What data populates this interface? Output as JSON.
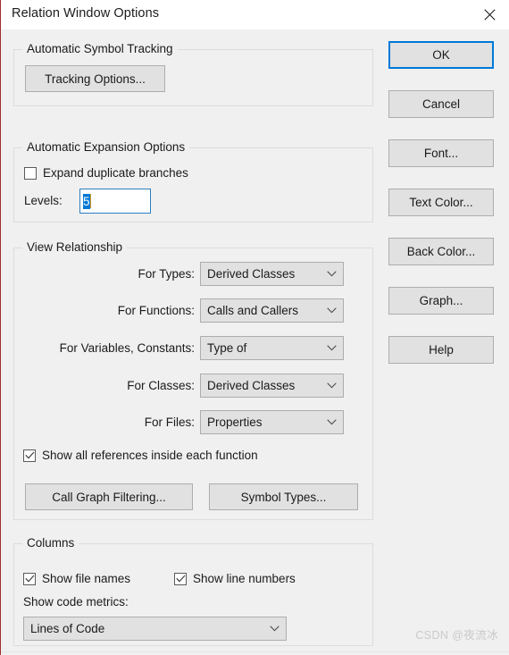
{
  "window": {
    "title": "Relation Window Options",
    "close_icon": "close-icon"
  },
  "groups": {
    "tracking": {
      "legend": "Automatic Symbol Tracking",
      "tracking_options_button": "Tracking Options..."
    },
    "expansion": {
      "legend": "Automatic Expansion Options",
      "expand_duplicate_branches": {
        "label": "Expand duplicate branches",
        "checked": false
      },
      "levels_label": "Levels:",
      "levels_value": "5"
    },
    "view_relationship": {
      "legend": "View Relationship",
      "rows": [
        {
          "label": "For Types:",
          "value": "Derived Classes"
        },
        {
          "label": "For Functions:",
          "value": "Calls and Callers"
        },
        {
          "label": "For Variables, Constants:",
          "value": "Type of"
        },
        {
          "label": "For Classes:",
          "value": "Derived Classes"
        },
        {
          "label": "For Files:",
          "value": "Properties"
        }
      ],
      "show_all_references": {
        "label": "Show all references inside each function",
        "checked": true
      },
      "call_graph_filtering_button": "Call Graph Filtering...",
      "symbol_types_button": "Symbol Types..."
    },
    "columns": {
      "legend": "Columns",
      "show_file_names": {
        "label": "Show file names",
        "checked": true
      },
      "show_line_numbers": {
        "label": "Show line numbers",
        "checked": true
      },
      "show_code_metrics_label": "Show code metrics:",
      "show_code_metrics_value": "Lines of Code"
    }
  },
  "buttons": [
    {
      "label": "OK",
      "default": true
    },
    {
      "label": "Cancel",
      "default": false
    },
    {
      "label": "Font...",
      "default": false
    },
    {
      "label": "Text Color...",
      "default": false
    },
    {
      "label": "Back Color...",
      "default": false
    },
    {
      "label": "Graph...",
      "default": false
    },
    {
      "label": "Help",
      "default": false
    }
  ],
  "watermark": "CSDN @夜流冰",
  "colors": {
    "accent": "#0078d7",
    "dialog_bg": "#f0f0f0",
    "control_bg": "#e1e1e1",
    "control_border": "#adadad",
    "group_border": "#dcdcdc",
    "selection": "#0078d7"
  }
}
